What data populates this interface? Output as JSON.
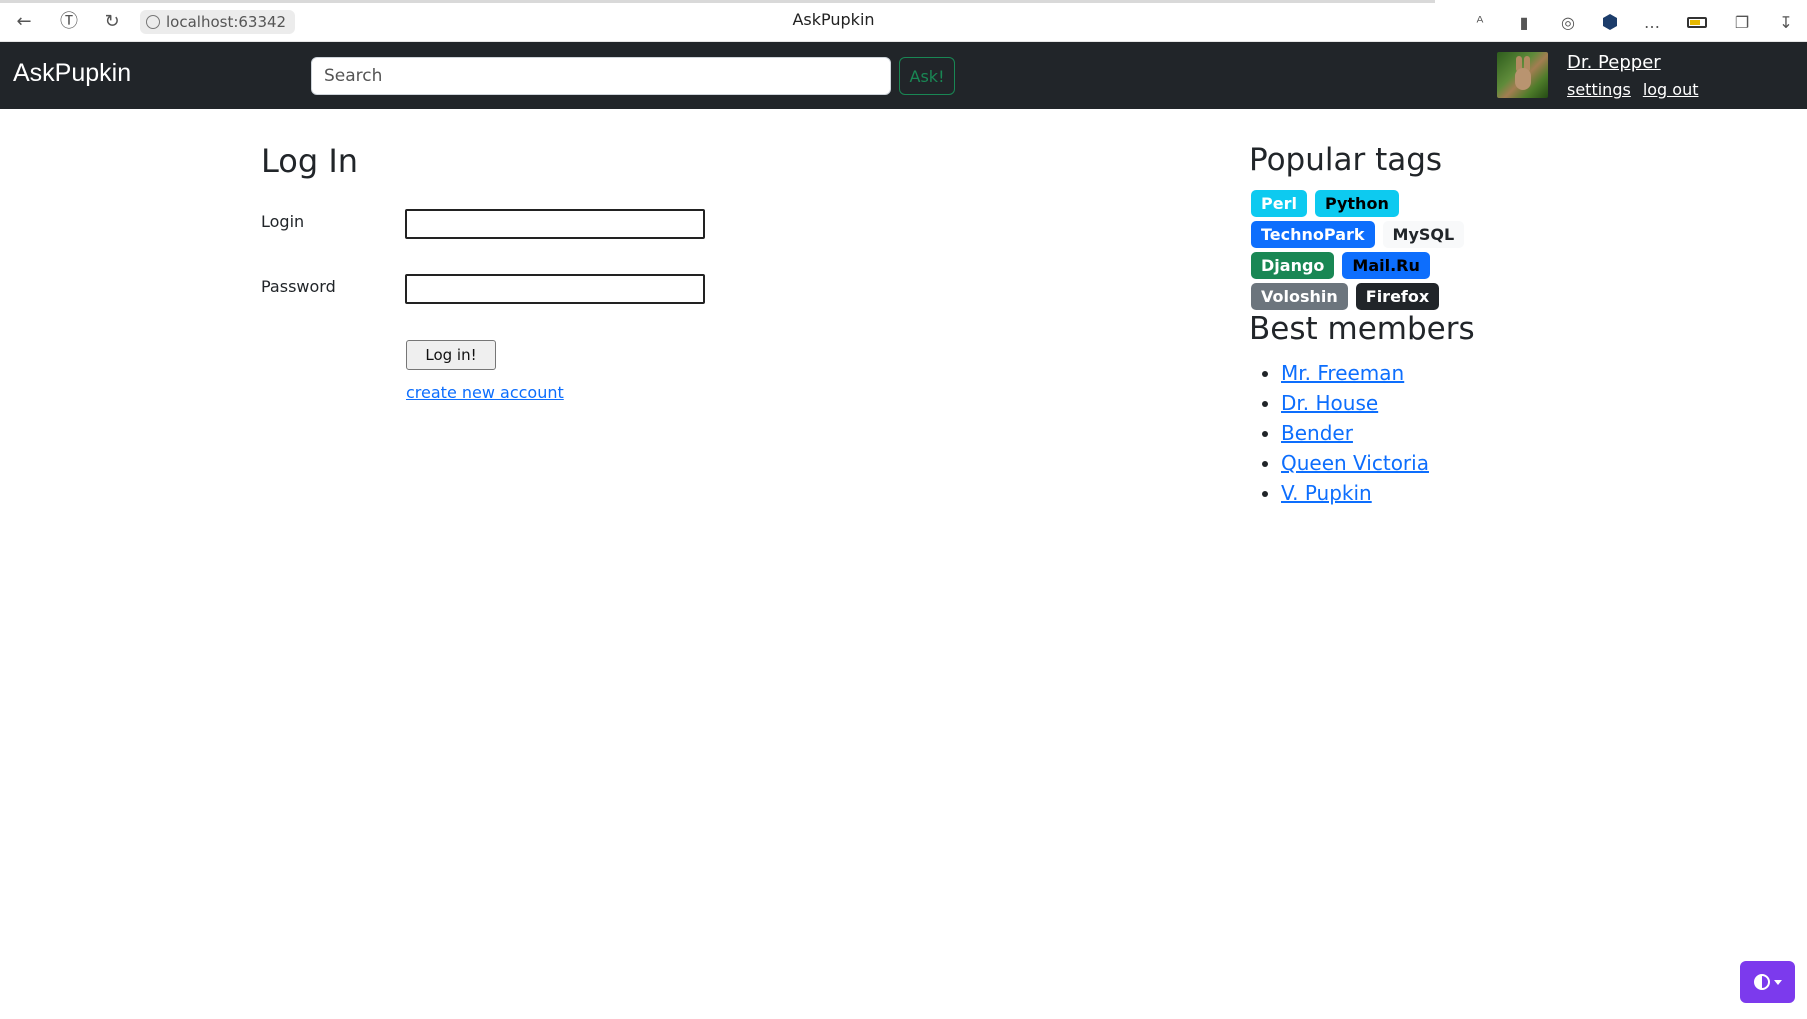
{
  "browser": {
    "url": "localhost:63342",
    "tab_title": "AskPupkin",
    "back_icon": "arrow-left-icon",
    "reload_icon": "reload-icon"
  },
  "navbar": {
    "brand": "AskPupkin",
    "search_placeholder": "Search",
    "ask_label": "Ask!",
    "user_name": "Dr. Pepper",
    "settings_label": "settings",
    "logout_label": "log out"
  },
  "login": {
    "title": "Log In",
    "login_label": "Login",
    "password_label": "Password",
    "submit_label": "Log in!",
    "create_account_label": "create new account"
  },
  "sidebar": {
    "tags_title": "Popular tags",
    "tags": [
      {
        "label": "Perl",
        "bg": "#0dcaf0",
        "fg": "#ffffff"
      },
      {
        "label": "Python",
        "bg": "#0dcaf0",
        "fg": "#000000"
      },
      {
        "label": "TechnoPark",
        "bg": "#0d6efd",
        "fg": "#ffffff"
      },
      {
        "label": "MySQL",
        "bg": "#f8f9fa",
        "fg": "#212529"
      },
      {
        "label": "Django",
        "bg": "#198754",
        "fg": "#ffffff"
      },
      {
        "label": "Mail.Ru",
        "bg": "#0d6efd",
        "fg": "#000000"
      },
      {
        "label": "Voloshin",
        "bg": "#6c757d",
        "fg": "#ffffff"
      },
      {
        "label": "Firefox",
        "bg": "#212529",
        "fg": "#ffffff"
      }
    ],
    "members_title": "Best members",
    "members": [
      "Mr. Freeman",
      "Dr. House",
      "Bender",
      "Queen Victoria",
      "V. Pupkin"
    ]
  },
  "colors": {
    "navbar_bg": "#212529",
    "link": "#0d6efd",
    "success": "#198754",
    "theme_button": "#7c3aed"
  }
}
